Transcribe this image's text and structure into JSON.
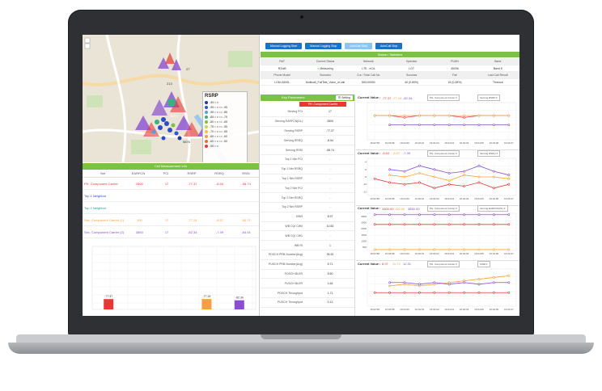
{
  "colors": {
    "green": "#7bc143",
    "red": "#e53935",
    "orange": "#f4a03c",
    "purple": "#8a4fd0",
    "blue": "#2b4cc7",
    "teal": "#1aa08e",
    "btn_blue": "#1a73c8"
  },
  "buttons": [
    "Manual Logging Start",
    "Manual Logging Stop",
    "AutoCall Start",
    "AutoCall Stop"
  ],
  "map": {
    "legend_title": "RSRP",
    "legend": [
      {
        "label": "-95 < x",
        "color": "#1e3c9c"
      },
      {
        "label": "-95 < x <= -95",
        "color": "#2d57d7"
      },
      {
        "label": "-95 < x <= -85",
        "color": "#4aa3df"
      },
      {
        "label": "-85 < x <= -75",
        "color": "#36b37e"
      },
      {
        "label": "-80 < x <= -65",
        "color": "#7bc143"
      },
      {
        "label": "-75 < x <= -55",
        "color": "#c4d94b"
      },
      {
        "label": "-70 < x <= -65",
        "color": "#f2c33a"
      },
      {
        "label": "-65 < x <= -60",
        "color": "#f4a03c"
      },
      {
        "label": "-60 < x <= -50",
        "color": "#ef6c2c"
      },
      {
        "label": "-55 < x",
        "color": "#e53935"
      }
    ],
    "cell_labels": [
      "27",
      "213",
      "5874",
      "5876"
    ]
  },
  "cell_info": {
    "title": "Cell Measurement Info",
    "headers": [
      "Set",
      "EARFCN",
      "PCI",
      "RSRP",
      "RSRQ",
      "RSSI"
    ],
    "rows": [
      {
        "set": "PH. Component Carrier",
        "earfcn": "2800",
        "pci": "17",
        "rsrp": "-77.37",
        "rsrq": "-8.54",
        "rssi": "-58.74",
        "color": "#e53935"
      },
      {
        "set": "Top 1 Neighbor",
        "earfcn": "",
        "pci": "",
        "rsrp": "",
        "rsrq": "",
        "rssi": "",
        "color": "#2b4cc7"
      },
      {
        "set": "Top 2 Neighbor",
        "earfcn": "",
        "pci": "",
        "rsrp": "",
        "rsrq": "",
        "rssi": "",
        "color": "#1aa08e"
      },
      {
        "set": "Sec. Component Carrier (1)",
        "earfcn": "100",
        "pci": "17",
        "rsrp": "-77.24",
        "rsrq": "-8.57",
        "rssi": "-60.71",
        "color": "#f4a03c"
      },
      {
        "set": "Sec. Component Carrier (2)",
        "earfcn": "3850",
        "pci": "17",
        "rsrp": "-82.34",
        "rsrq": "-7.39",
        "rssi": "-64.51",
        "color": "#8a4fd0"
      }
    ]
  },
  "bar_values": [
    {
      "label": "-77.37",
      "value": -77.37,
      "color": "#e53935"
    },
    {
      "label": "",
      "value": null,
      "color": "#2b4cc7"
    },
    {
      "label": "",
      "value": null,
      "color": "#1aa08e"
    },
    {
      "label": "-77.24",
      "value": -77.24,
      "color": "#f4a03c"
    },
    {
      "label": "-82.34",
      "value": -82.34,
      "color": "#8a4fd0"
    }
  ],
  "status": {
    "title": "Status / Statistics",
    "headers1": [
      "RAT",
      "Current Status",
      "Network",
      "Operator",
      "PLMN",
      "Band"
    ],
    "row1": [
      "R2/aB",
      "Measuring",
      "LTE - eCA",
      "LGT",
      "45006",
      "Band 5"
    ],
    "headers2": [
      "Phone Model",
      "Scenario",
      "Cur / Total Call No",
      "Success",
      "Fail",
      "Last Call Result"
    ],
    "row2": [
      "LGM-G600L",
      "Multicall_FullTest_Voice_m.call",
      "55/100000",
      "40 (0.89%)",
      "15 (0.08%)",
      "Timeout"
    ]
  },
  "key_params": {
    "title": "Key Parameters",
    "setting": "Setting",
    "pcc": "PH. Component Carrier",
    "items": [
      {
        "k": "Serving PCI",
        "v": "17"
      },
      {
        "k": "Serving EARFCN(DL)",
        "v": "2800"
      },
      {
        "k": "Serving RSRP",
        "v": "-77.37"
      },
      {
        "k": "Serving RSRQ",
        "v": "-8.54"
      },
      {
        "k": "Serving RSSI",
        "v": "-58.74"
      },
      {
        "k": "Top 1 Nbr PCI",
        "v": "-"
      },
      {
        "k": "Top 1 Nbr RSRQ",
        "v": "-"
      },
      {
        "k": "Top 1 Nbr RSRP",
        "v": "-"
      },
      {
        "k": "Top 2 Nbr PCI",
        "v": "-"
      },
      {
        "k": "Top 2 Nbr RSRQ",
        "v": "-"
      },
      {
        "k": "Top 2 Nbr RSRP",
        "v": "-"
      },
      {
        "k": "SINR",
        "v": "8.97"
      },
      {
        "k": "WB CQI CW0",
        "v": "10.63"
      },
      {
        "k": "WB CQI CW1",
        "v": "-"
      },
      {
        "k": "WB RI",
        "v": "1"
      },
      {
        "k": "PDSCH PRB Number(Avg)",
        "v": "26.92"
      },
      {
        "k": "PUSCH PRB Number(Avg)",
        "v": "5.71"
      },
      {
        "k": "PDSCH BLER",
        "v": "5.50"
      },
      {
        "k": "PUSCH BLER",
        "v": "1.64"
      },
      {
        "k": "PDSCH Throughput",
        "v": "1.71"
      },
      {
        "k": "PUSCH Throughput",
        "v": "0.12"
      }
    ]
  },
  "time_ticks": [
    "16:02:58",
    "16:03:58",
    "16:04:00",
    "16:04:01",
    "16:04:02",
    "16:04:03",
    "16:04:04",
    "16:04:05",
    "16:04:06",
    "16:04:07"
  ],
  "charts": [
    {
      "label": "Current Value :",
      "values": [
        "-77.37",
        "-77.24",
        "-82.34"
      ],
      "dd1": "PH. Component Carrier",
      "dd2": "Serving RSRP",
      "series": [
        {
          "color": "#e53935",
          "y": [
            -77,
            -77,
            -78,
            -77,
            -77,
            -77,
            -78,
            -77,
            -77,
            -77
          ]
        },
        {
          "color": "#f4a03c",
          "y": [
            -77,
            -77,
            -77,
            -77,
            -77,
            -77,
            -77,
            -77,
            -77,
            -77
          ]
        },
        {
          "color": "#8a4fd0",
          "y": [
            null,
            -82,
            -82,
            -82,
            -82,
            -82,
            -82,
            -82,
            -82,
            -82
          ]
        }
      ],
      "ymin": -90,
      "ymax": -70,
      "yticks": []
    },
    {
      "label": "Current Value :",
      "values": [
        "-8.54",
        "-8.57",
        "-7.39"
      ],
      "dd1": "PH. Component Carrier",
      "dd2": "Serving RSRQ",
      "series": [
        {
          "color": "#e53935",
          "y": [
            -8.5,
            -9.5,
            -10,
            -9.5,
            -11,
            -10,
            -10.5,
            -9.5,
            -11,
            -10
          ]
        },
        {
          "color": "#f4a03c",
          "y": [
            null,
            -7.5,
            -8,
            -7,
            -8,
            -9,
            -7.5,
            -8,
            -8,
            -8.5
          ]
        },
        {
          "color": "#8a4fd0",
          "y": [
            null,
            -6,
            -6.5,
            -5,
            -6,
            -7,
            -6.5,
            -5,
            -6.5,
            -7.5
          ]
        }
      ],
      "ymin": -13,
      "ymax": -3,
      "yticks": [
        "-4",
        "-6",
        "-8",
        "-10",
        "-12"
      ]
    },
    {
      "label": "Current Value :",
      "values": [
        "2800.00",
        "100.00",
        "3850.00"
      ],
      "dd1": "PH. Component Carrier",
      "dd2": "Serving EARFCN(DL)",
      "series": [
        {
          "color": "#e53935",
          "y": [
            2800,
            2800,
            2800,
            2800,
            2800,
            2800,
            2800,
            2800,
            2800,
            2800
          ]
        },
        {
          "color": "#f4a03c",
          "y": [
            100,
            100,
            100,
            100,
            100,
            100,
            100,
            100,
            100,
            100
          ]
        },
        {
          "color": "#8a4fd0",
          "y": [
            3850,
            3850,
            3850,
            3850,
            3850,
            3850,
            3850,
            3850,
            3850,
            3850
          ]
        }
      ],
      "ymin": 0,
      "ymax": 4000,
      "yticks": [
        "3000",
        "2500",
        "2000",
        "1500",
        "1000",
        "500"
      ]
    },
    {
      "label": "Current Value :",
      "values": [
        "8.97",
        "11.72",
        "12.31"
      ],
      "dd1": "PH. Component Carrier",
      "dd2": "SINR",
      "series": [
        {
          "color": "#e53935",
          "y": [
            9,
            9,
            9,
            9,
            9,
            9,
            9,
            9,
            9,
            9
          ]
        },
        {
          "color": "#f4a03c",
          "y": [
            null,
            11,
            11.5,
            11,
            11.5,
            12,
            12.5,
            13,
            13.5,
            14
          ]
        },
        {
          "color": "#8a4fd0",
          "y": [
            null,
            12,
            12,
            11.5,
            12,
            11.5,
            12,
            11.5,
            12,
            12
          ]
        }
      ],
      "ymin": 5,
      "ymax": 16,
      "yticks": []
    }
  ]
}
